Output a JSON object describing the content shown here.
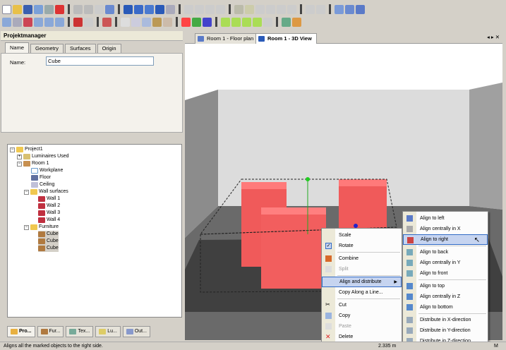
{
  "panel": {
    "title": "Projektmanager",
    "tabs": [
      "Name",
      "Geometry",
      "Surfaces",
      "Origin"
    ],
    "name_label": "Name:",
    "name_value": "Cube"
  },
  "tree": {
    "items": [
      {
        "label": "Project1",
        "icon": "folder-icon"
      },
      {
        "label": "Luminaires Used",
        "icon": "luminaires-icon"
      },
      {
        "label": "Room 1",
        "icon": "room-icon"
      },
      {
        "label": "Workplane",
        "icon": "workplane-icon"
      },
      {
        "label": "Floor",
        "icon": "floor-icon"
      },
      {
        "label": "Ceiling",
        "icon": "ceiling-icon"
      },
      {
        "label": "Wall surfaces",
        "icon": "folder-icon"
      },
      {
        "label": "Wall 1",
        "icon": "wall-icon"
      },
      {
        "label": "Wall 2",
        "icon": "wall-icon"
      },
      {
        "label": "Wall 3",
        "icon": "wall-icon"
      },
      {
        "label": "Wall 4",
        "icon": "wall-icon"
      },
      {
        "label": "Furniture",
        "icon": "folder-icon"
      },
      {
        "label": "Cube",
        "icon": "furniture-icon"
      },
      {
        "label": "Cube",
        "icon": "furniture-icon"
      },
      {
        "label": "Cube",
        "icon": "furniture-icon"
      }
    ]
  },
  "bottom_tabs": [
    "Pro...",
    "Fur...",
    "Tex...",
    "Lu...",
    "Out..."
  ],
  "view_tabs": [
    "Room 1 - Floor plan",
    "Room 1 - 3D View"
  ],
  "view_controls": "◂ ▸ ✕",
  "context_menu": {
    "items": [
      {
        "label": "Scale"
      },
      {
        "label": "Rotate"
      },
      {
        "label": "Combine"
      },
      {
        "label": "Split"
      },
      {
        "label": "Align and distribute"
      },
      {
        "label": "Copy Along a Line..."
      },
      {
        "label": "Cut"
      },
      {
        "label": "Copy"
      },
      {
        "label": "Paste"
      },
      {
        "label": "Delete"
      }
    ]
  },
  "submenu": {
    "items": [
      {
        "label": "Align to left"
      },
      {
        "label": "Align centrally in X"
      },
      {
        "label": "Align to right"
      },
      {
        "label": "Align to back"
      },
      {
        "label": "Align centrally in Y"
      },
      {
        "label": "Align to front"
      },
      {
        "label": "Align to top"
      },
      {
        "label": "Align centrally in Z"
      },
      {
        "label": "Align to bottom"
      },
      {
        "label": "Distribute in X-direction"
      },
      {
        "label": "Distribute in Y-direction"
      },
      {
        "label": "Distribute in Z-direction"
      }
    ]
  },
  "status": {
    "text": "Aligns all the marked objects to the right side.",
    "coord": "2.335 m",
    "unit": "M"
  },
  "colors": {
    "cube": "#f05a5a",
    "highlight": "#c6d4f0"
  }
}
